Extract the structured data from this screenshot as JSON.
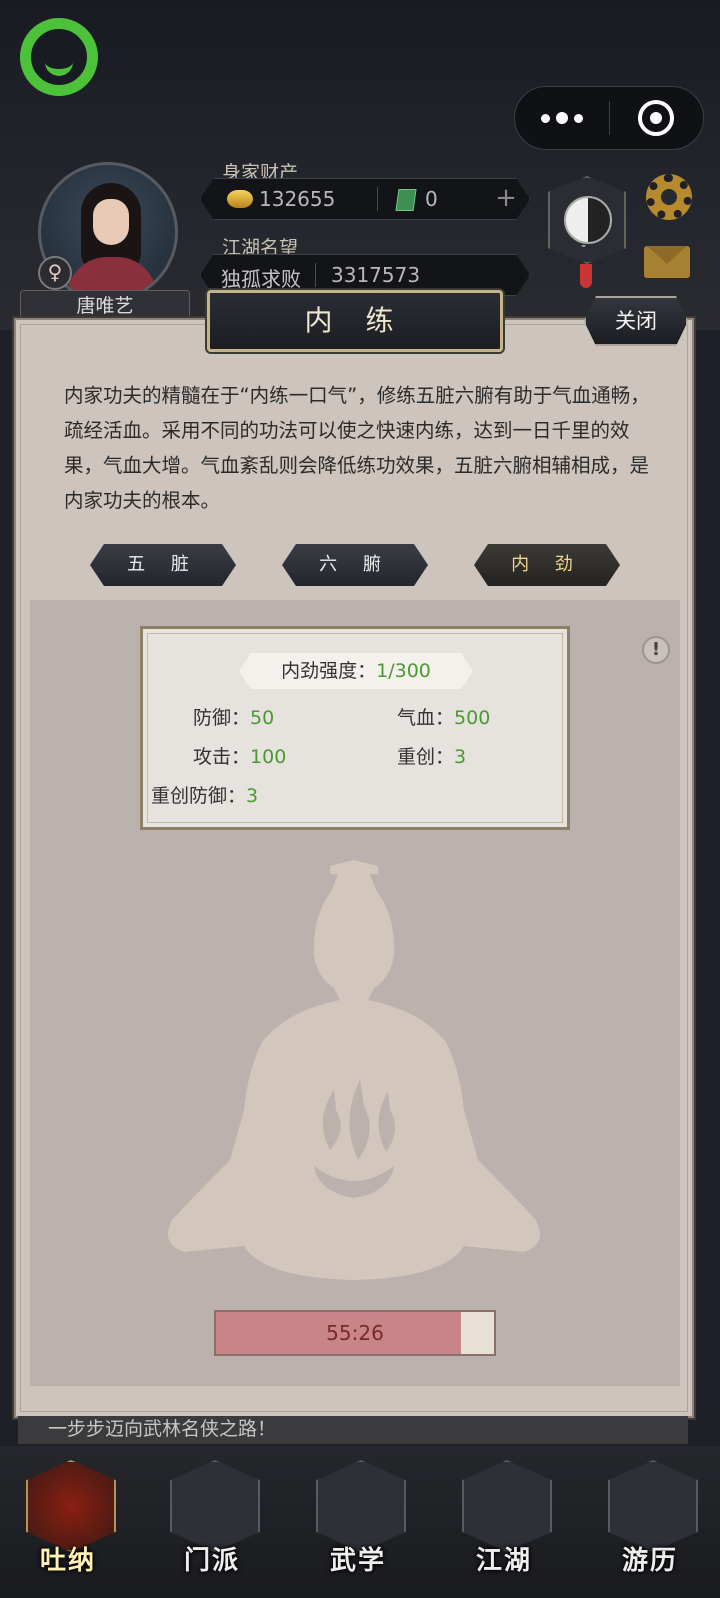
{
  "hud": {
    "wealth_label": "身家财产",
    "gold": "132655",
    "jade": "0",
    "plus": "+",
    "fame_label": "江湖名望",
    "fame_title": "独孤求败",
    "fame_value": "3317573",
    "player_name": "唐唯艺",
    "gender_symbol": "♀",
    "taiji_level": "-",
    "accent_green": "#4cc23b"
  },
  "dialog": {
    "title": "内 练",
    "close_label": "关闭",
    "intro": "内家功夫的精髓在于“内练一口气”，修练五脏六腑有助于气血通畅，疏经活血。采用不同的功法可以使之快速内练，达到一日千里的效果，气血大增。气血紊乱则会降低练功效果，五脏六腑相辅相成，是内家功夫的根本。",
    "tabs": [
      {
        "label": "五 脏",
        "active": false
      },
      {
        "label": "六 腑",
        "active": false
      },
      {
        "label": "内 劲",
        "active": true
      }
    ],
    "info_symbol": "!",
    "stats": {
      "strength_label": "内劲强度：",
      "strength_value": "1/300",
      "defense_label": "防御：",
      "defense_value": "50",
      "hp_label": "气血：",
      "hp_value": "500",
      "attack_label": "攻击：",
      "attack_value": "100",
      "crit_label": "重创：",
      "crit_value": "3",
      "crit_def_label": "重创防御：",
      "crit_def_value": "3"
    },
    "timer": {
      "text": "55:26",
      "progress": 0.88
    }
  },
  "slogan": "一步步迈向武林名侠之路！",
  "nav": [
    {
      "label": "吐纳",
      "active": true
    },
    {
      "label": "门派",
      "active": false
    },
    {
      "label": "武学",
      "active": false
    },
    {
      "label": "江湖",
      "active": false
    },
    {
      "label": "游历",
      "active": false
    }
  ]
}
